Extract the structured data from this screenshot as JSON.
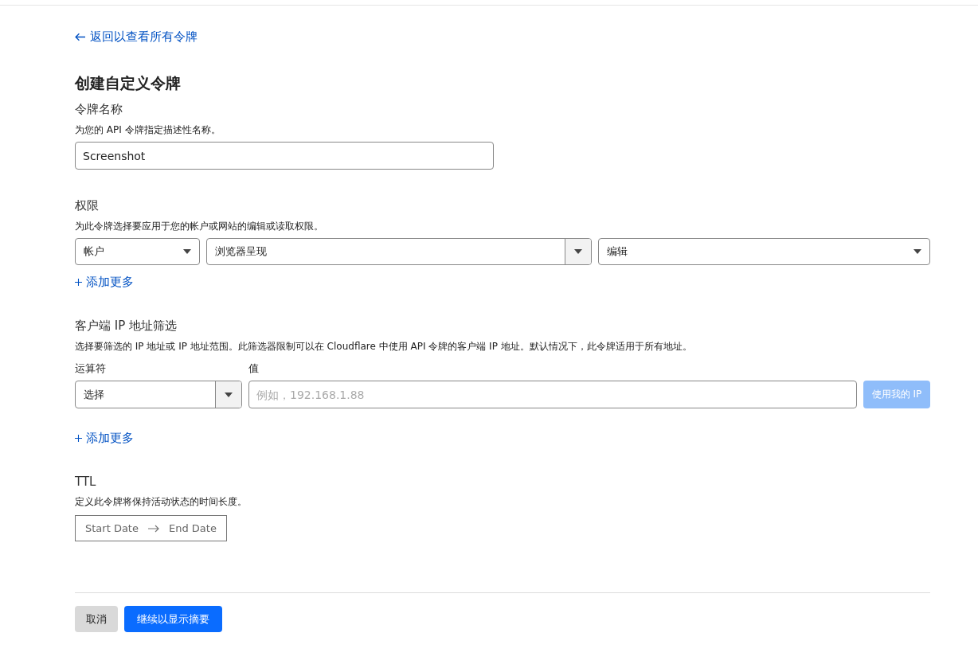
{
  "back_link": {
    "label": "返回以查看所有令牌"
  },
  "title": "创建自定义令牌",
  "token_name": {
    "label": "令牌名称",
    "description": "为您的 API 令牌指定描述性名称。",
    "value": "Screenshot"
  },
  "permissions": {
    "label": "权限",
    "description": "为此令牌选择要应用于您的帐户或网站的编辑或读取权限。",
    "selects": [
      {
        "kind": "plain",
        "value": "帐户"
      },
      {
        "kind": "split",
        "value": "浏览器呈现"
      },
      {
        "kind": "plain",
        "value": "编辑"
      }
    ],
    "add_more": "添加更多"
  },
  "ip_filter": {
    "label": "客户端 IP 地址筛选",
    "description": "选择要筛选的 IP 地址或 IP 地址范围。此筛选器限制可以在 Cloudflare 中使用 API 令牌的客户端 IP 地址。默认情况下，此令牌适用于所有地址。",
    "operator_label": "运算符",
    "operator": {
      "kind": "split",
      "value": "选择"
    },
    "value_label": "值",
    "value_placeholder": "例如，192.168.1.88",
    "use_my_ip": {
      "label": "使用我的 IP",
      "disabled": true
    },
    "add_more": "添加更多"
  },
  "ttl": {
    "label": "TTL",
    "description": "定义此令牌将保持活动状态的时间长度。",
    "start_placeholder": "Start Date",
    "end_placeholder": "End Date"
  },
  "buttons": [
    {
      "kind": "secondary",
      "label": "取消"
    },
    {
      "kind": "primary",
      "label": "继续以显示摘要"
    }
  ]
}
